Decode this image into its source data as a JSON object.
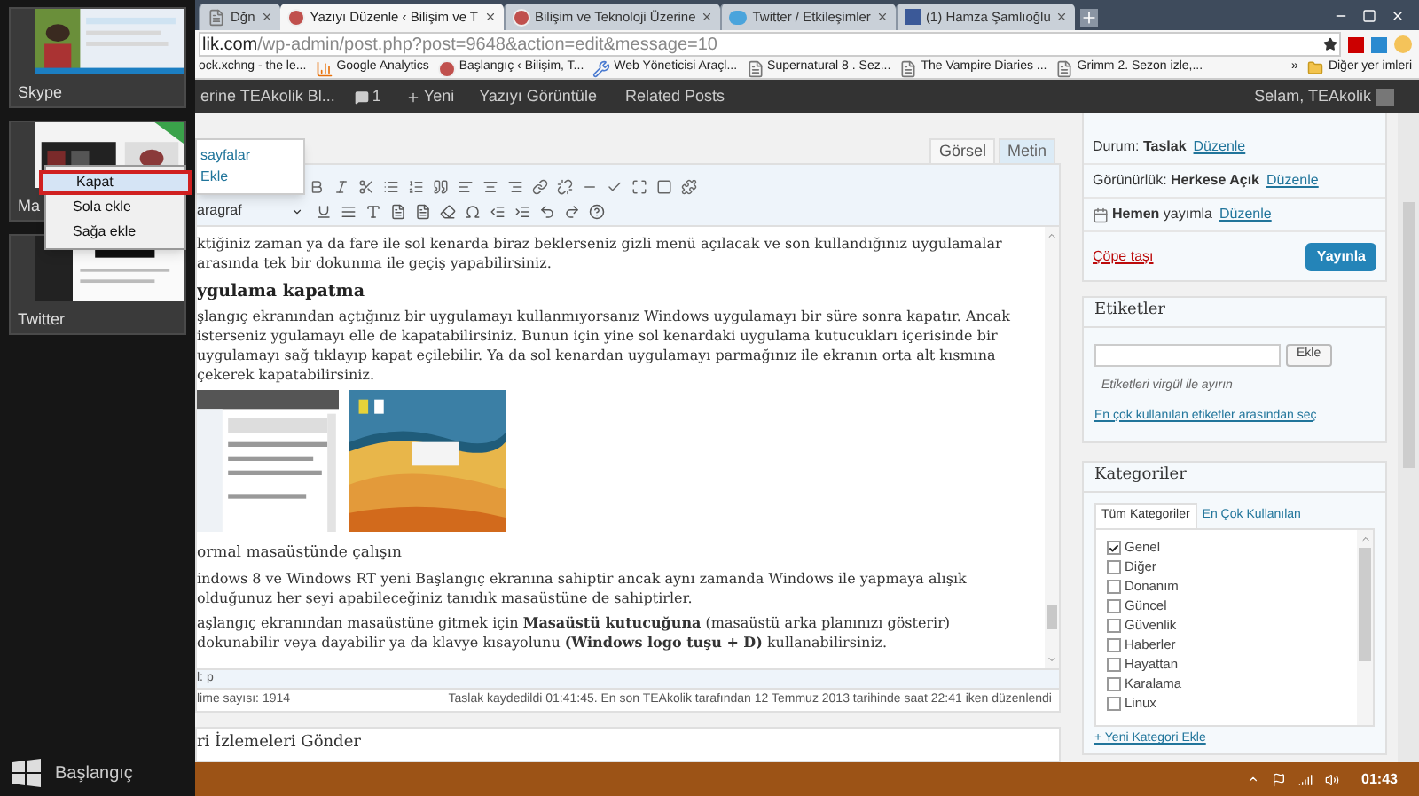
{
  "switcher": {
    "apps": [
      {
        "label": "Skype"
      },
      {
        "label": "Ma"
      },
      {
        "label": "Twitter"
      }
    ],
    "context_menu": [
      {
        "label": "Kapat",
        "selected": true
      },
      {
        "label": "Sola ekle",
        "selected": false
      },
      {
        "label": "Sağa ekle",
        "selected": false
      }
    ],
    "start_label": "Başlangıç"
  },
  "browser": {
    "tabs": [
      {
        "title": "Dğn",
        "selected": false
      },
      {
        "title": "Yazıyı Düzenle ‹ Bilişim ve T",
        "selected": true
      },
      {
        "title": "Bilişim ve Teknoloji Üzerine",
        "selected": false
      },
      {
        "title": "Twitter / Etkileşimler",
        "selected": false
      },
      {
        "title": "(1) Hamza Şamlıoğlu",
        "selected": false
      }
    ],
    "url": {
      "host": "lik.com",
      "path": "/wp-admin/post.php?post=9648&action=edit&message=10"
    },
    "bookmarks": [
      {
        "label": "ock.xchng - the le..."
      },
      {
        "label": "Google Analytics"
      },
      {
        "label": "Başlangıç ‹ Bilişim, T..."
      },
      {
        "label": "Web Yöneticisi Araçl..."
      },
      {
        "label": "Supernatural 8 . Sez..."
      },
      {
        "label": "The Vampire Diaries ..."
      },
      {
        "label": "Grimm 2. Sezon izle,..."
      }
    ],
    "more": "»",
    "other_bookmarks": "Diğer yer imleri"
  },
  "admin_bar": {
    "site": "erine TEAkolik Bl...",
    "comments": "1",
    "new": "Yeni",
    "view": "Yazıyı Görüntüle",
    "related": "Related Posts",
    "greeting": "Selam, TEAkolik"
  },
  "editor": {
    "dropdown": [
      "sayfalar",
      "Ekle"
    ],
    "mode_tabs": [
      {
        "label": "Görsel",
        "selected": true
      },
      {
        "label": "Metin",
        "selected": false
      }
    ],
    "format": "aragraf",
    "content": [
      {
        "kind": "paragraph",
        "text": "ktiğiniz zaman ya da fare ile sol kenarda biraz beklerseniz gizli menü açılacak ve son kullandığınız uygulamalar arasında tek bir dokunma ile geçiş yapabilirsiniz."
      },
      {
        "kind": "heading",
        "text": "ygulama kapatma"
      },
      {
        "kind": "paragraph",
        "text": "şlangıç ekranından açtığınız bir uygulamayı kullanmıyorsanız Windows uygulamayı bir süre sonra kapatır. Ancak isterseniz ygulamayı elle de kapatabilirsiniz. Bunun için yine sol kenardaki uygulama kutucukları içerisinde bir uygulamayı sağ tıklayıp kapat eçilebilir. Ya da sol kenardan uygulamayı parmağınız ile ekranın orta alt kısmına çekerek kapatabilirsiniz."
      },
      {
        "kind": "images"
      },
      {
        "kind": "subheading",
        "text": "ormal masaüstünde çalışın"
      },
      {
        "kind": "paragraph",
        "text": "indows 8 ve Windows RT yeni Başlangıç ekranına sahiptir ancak aynı zamanda Windows ile yapmaya alışık olduğunuz her şeyi apabileceğiniz tanıdık masaüstüne de sahiptirler."
      },
      {
        "kind": "paragraph",
        "text": "aşlangıç ekranından masaüstüne gitmek için **Masaüstü kutucuğuna** (masaüstü arka planınızı gösterir) dokunabilir veya dayabilir ya da klavye kısayolunu **(Windows logo tuşu + D)** kullanabilirsiniz."
      }
    ],
    "path": "l: p",
    "word_count": "lime sayısı: 1914",
    "saved": "Taslak kaydedildi 01:41:45. En son TEAkolik tarafından 12 Temmuz 2013 tarihinde saat 22:41 iken düzenlendi",
    "next_box": "ri İzlemeleri Gönder"
  },
  "sidebar": {
    "publish": {
      "rows": [
        {
          "kind": "status",
          "text": "Durum: **Taslak**",
          "link": "Düzenle"
        },
        {
          "kind": "status",
          "text": "Görünürlük: **Herkese Açık**",
          "link": "Düzenle"
        },
        {
          "kind": "schedule",
          "text": "**Hemen** yayımla",
          "link": "Düzenle"
        }
      ],
      "trash": "Çöpe taşı",
      "button": "Yayınla"
    },
    "tags": {
      "title": "Etiketler",
      "button": "Ekle",
      "hint": "Etiketleri virgül ile ayırın",
      "link": "En çok kullanılan etiketler arasından seç"
    },
    "categories": {
      "title": "Kategoriler",
      "tabs": [
        {
          "label": "Tüm Kategoriler",
          "selected": true
        },
        {
          "label": "En Çok Kullanılan",
          "selected": false
        }
      ],
      "items": [
        {
          "label": "Genel",
          "checked": true
        },
        {
          "label": "Diğer",
          "checked": false
        },
        {
          "label": "Donanım",
          "checked": false
        },
        {
          "label": "Güncel",
          "checked": false
        },
        {
          "label": "Güvenlik",
          "checked": false
        },
        {
          "label": "Haberler",
          "checked": false
        },
        {
          "label": "Hayattan",
          "checked": false
        },
        {
          "label": "Karalama",
          "checked": false
        },
        {
          "label": "Linux",
          "checked": false
        }
      ],
      "add": "+ Yeni Kategori Ekle"
    }
  },
  "taskbar": {
    "time": "01:43"
  }
}
